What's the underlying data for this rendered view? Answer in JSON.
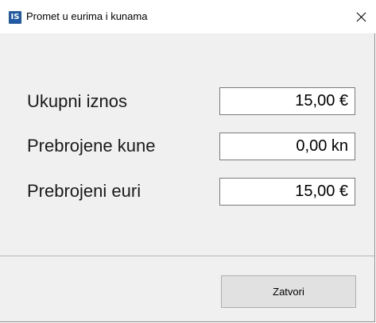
{
  "window": {
    "title": "Promet u eurima i kunama",
    "icon_text": "IS",
    "icon": "app-icon",
    "accent_color": "#1e5aa8"
  },
  "fields": [
    {
      "label": "Ukupni iznos",
      "value": "15,00 €"
    },
    {
      "label": "Prebrojene kune",
      "value": "0,00 kn"
    },
    {
      "label": "Prebrojeni euri",
      "value": "15,00 €"
    }
  ],
  "buttons": {
    "close_label": "Zatvori"
  }
}
